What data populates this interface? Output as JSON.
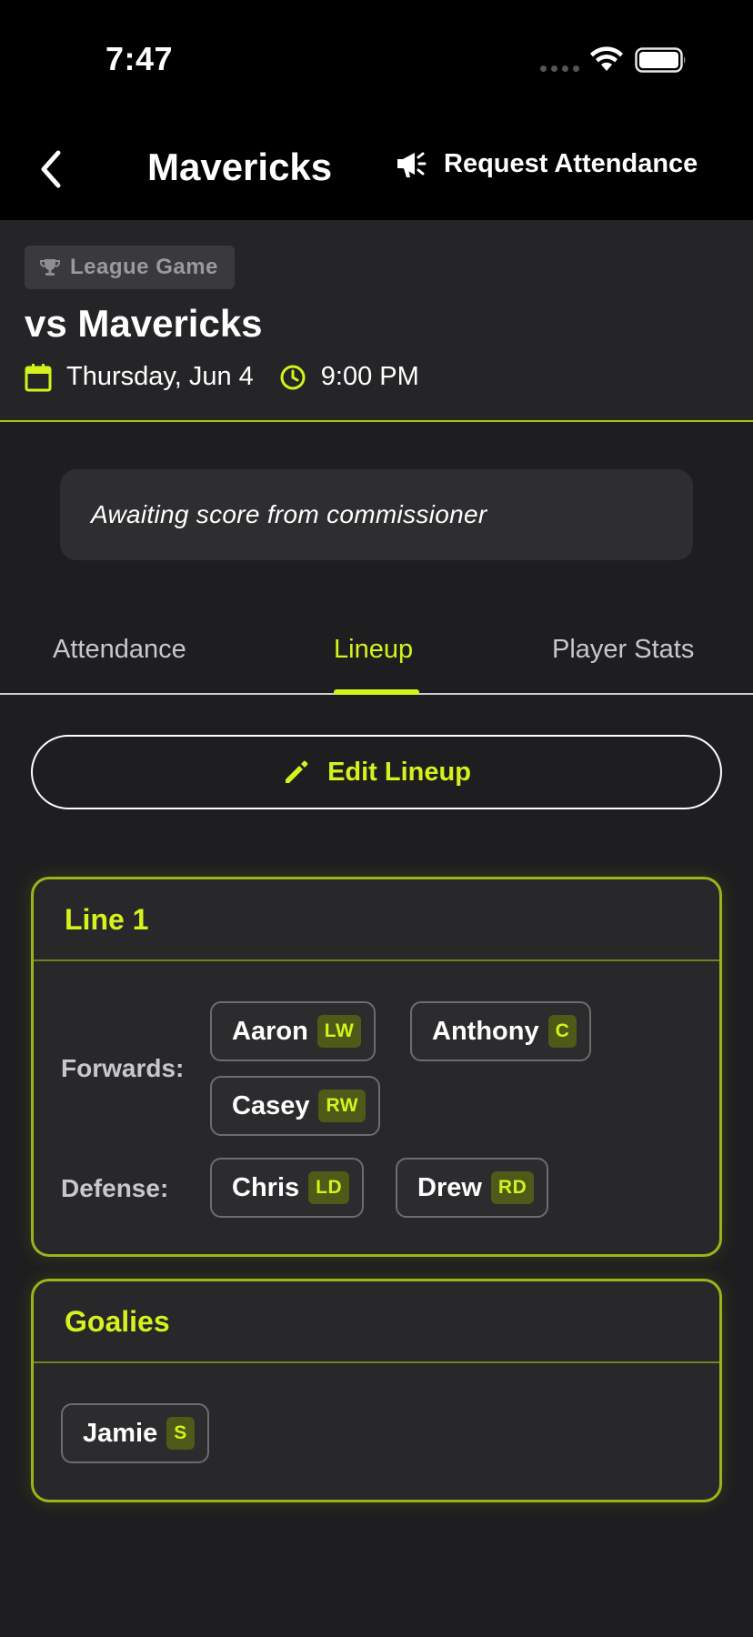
{
  "status_bar": {
    "time": "7:47"
  },
  "nav": {
    "title": "Mavericks",
    "request_label": "Request Attendance"
  },
  "game": {
    "type_label": "League Game",
    "opponent": "vs Mavericks",
    "date": "Thursday, Jun 4",
    "time": "9:00 PM"
  },
  "score_banner": {
    "text": "Awaiting score from commissioner"
  },
  "tabs": [
    {
      "label": "Attendance",
      "active": false
    },
    {
      "label": "Lineup",
      "active": true
    },
    {
      "label": "Player Stats",
      "active": false
    }
  ],
  "edit_button": {
    "label": "Edit Lineup"
  },
  "lines": [
    {
      "title": "Line 1",
      "forwards_label": "Forwards:",
      "defense_label": "Defense:",
      "forwards": [
        {
          "name": "Aaron",
          "pos": "LW"
        },
        {
          "name": "Anthony",
          "pos": "C"
        },
        {
          "name": "Casey",
          "pos": "RW"
        }
      ],
      "defense": [
        {
          "name": "Chris",
          "pos": "LD"
        },
        {
          "name": "Drew",
          "pos": "RD"
        }
      ]
    }
  ],
  "goalies": {
    "title": "Goalies",
    "players": [
      {
        "name": "Jamie",
        "pos": "S"
      }
    ]
  },
  "colors": {
    "accent": "#d4f21c",
    "background": "#1e1e20",
    "card_border": "#9ab51a",
    "position_badge": "#4d5a18"
  },
  "icons": [
    "back-chevron-icon",
    "megaphone-icon",
    "trophy-icon",
    "calendar-icon",
    "clock-icon",
    "pencil-icon",
    "wifi-icon",
    "battery-icon"
  ]
}
